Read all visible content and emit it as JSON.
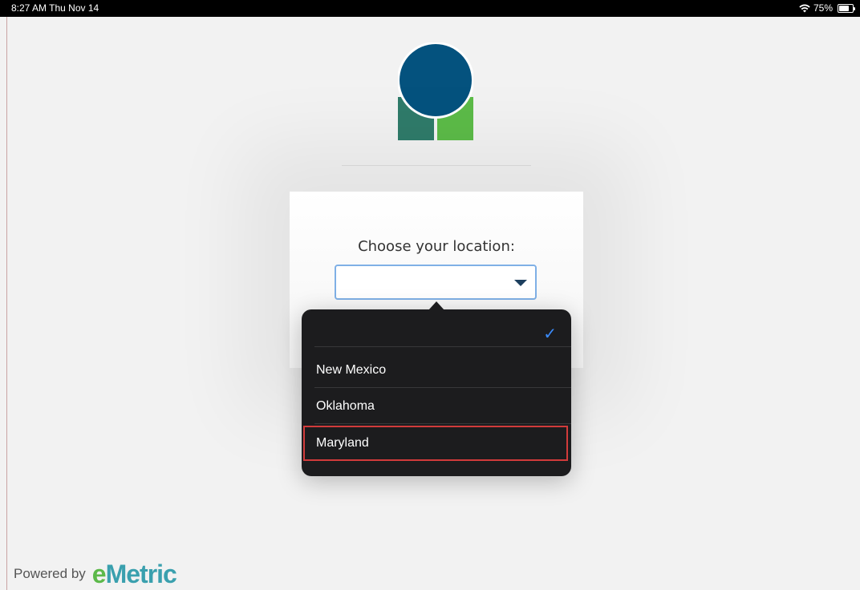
{
  "status_bar": {
    "time": "8:27 AM  Thu Nov 14",
    "battery": "75%",
    "battery_level": 0.75
  },
  "logo": {
    "icon": "logo-circle-squares-icon",
    "colors": {
      "circle": "#04527e",
      "left_square": "#2f7b6a",
      "right_square": "#5cbb48"
    }
  },
  "location_picker": {
    "label": "Choose your location:",
    "selected_value": "",
    "options": [
      {
        "label": "",
        "selected": true
      },
      {
        "label": "New Mexico",
        "selected": false
      },
      {
        "label": "Oklahoma",
        "selected": false
      },
      {
        "label": "Maryland",
        "selected": false,
        "highlighted": true
      }
    ],
    "check_icon": "checkmark-icon",
    "accent": "#3b8cff",
    "highlight_color": "#d23b3b"
  },
  "footer": {
    "powered_by": "Powered by",
    "brand_e": "e",
    "brand_rest": "Metric"
  }
}
